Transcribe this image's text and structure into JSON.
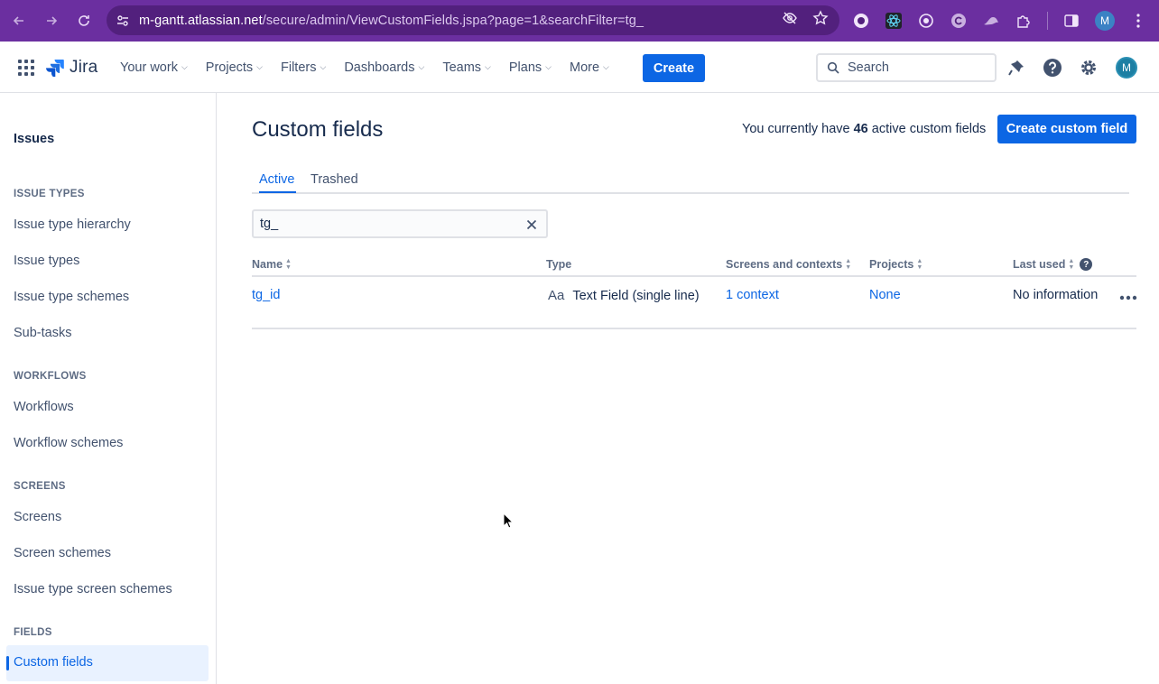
{
  "browser": {
    "url_host": "m-gantt.atlassian.net",
    "url_path": "/secure/admin/ViewCustomFields.jspa?page=1&searchFilter=tg_",
    "profile_initial": "M"
  },
  "topnav": {
    "logo": "Jira",
    "items": [
      "Your work",
      "Projects",
      "Filters",
      "Dashboards",
      "Teams",
      "Plans",
      "More"
    ],
    "create_label": "Create",
    "search_placeholder": "Search",
    "avatar_initial": "M"
  },
  "sidebar": {
    "title": "Issues",
    "sections": [
      {
        "label": "ISSUE TYPES",
        "items": [
          "Issue type hierarchy",
          "Issue types",
          "Issue type schemes",
          "Sub-tasks"
        ]
      },
      {
        "label": "WORKFLOWS",
        "items": [
          "Workflows",
          "Workflow schemes"
        ]
      },
      {
        "label": "SCREENS",
        "items": [
          "Screens",
          "Screen schemes",
          "Issue type screen schemes"
        ]
      },
      {
        "label": "FIELDS",
        "items": [
          "Custom fields"
        ]
      }
    ]
  },
  "main": {
    "title": "Custom fields",
    "active_note_prefix": "You currently have",
    "active_count": "46",
    "active_note_suffix": "active custom fields",
    "create_button": "Create custom field",
    "tabs": [
      "Active",
      "Trashed"
    ],
    "filter_value": "tg_",
    "columns": [
      "Name",
      "Type",
      "Screens and contexts",
      "Projects",
      "Last used"
    ],
    "rows": [
      {
        "name": "tg_id",
        "type_icon": "Aa",
        "type": "Text Field (single line)",
        "contexts": "1 context",
        "projects": "None",
        "last_used": "No information"
      }
    ]
  },
  "colors": {
    "browser_chrome": "#6b2fa0",
    "primary": "#0c66e4",
    "text": "#172b4d"
  }
}
